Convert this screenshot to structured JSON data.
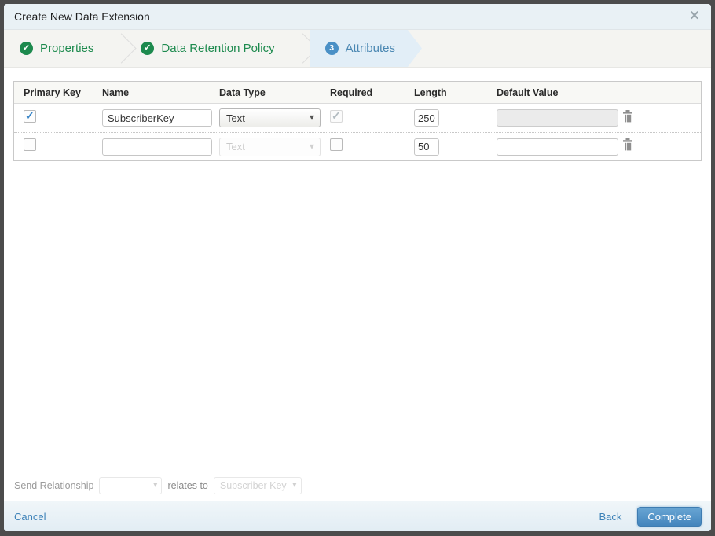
{
  "modal": {
    "title": "Create New Data Extension"
  },
  "wizard": {
    "steps": [
      {
        "label": "Properties",
        "status": "complete"
      },
      {
        "label": "Data Retention Policy",
        "status": "complete"
      },
      {
        "label": "Attributes",
        "status": "active",
        "number": "3"
      }
    ]
  },
  "table": {
    "headers": {
      "primary_key": "Primary Key",
      "name": "Name",
      "data_type": "Data Type",
      "required": "Required",
      "length": "Length",
      "default_value": "Default Value"
    },
    "rows": [
      {
        "primary_key_checked": true,
        "name": "SubscriberKey",
        "data_type": "Text",
        "data_type_disabled": false,
        "required_checked": true,
        "required_disabled": true,
        "length": "250",
        "default_value": "",
        "default_value_disabled": true
      },
      {
        "primary_key_checked": false,
        "name": "",
        "data_type": "Text",
        "data_type_disabled": true,
        "required_checked": false,
        "required_disabled": false,
        "length": "50",
        "default_value": "",
        "default_value_disabled": false
      }
    ]
  },
  "send_relationship": {
    "label": "Send Relationship",
    "relation_value": "",
    "relates_label": "relates to",
    "target_value": "Subscriber Key"
  },
  "footer": {
    "cancel": "Cancel",
    "back": "Back",
    "complete": "Complete"
  },
  "colors": {
    "step_complete_green": "#1d8a4e",
    "step_active_blue": "#4a87b2",
    "step_active_bg": "#e2eef7",
    "link_blue": "#3d82b8",
    "primary_button_blue": "#4385bd",
    "checkbox_check_blue": "#3b87c8",
    "titlebar_bg": "#e9f1f5",
    "wizard_bg": "#f4f4f1"
  }
}
